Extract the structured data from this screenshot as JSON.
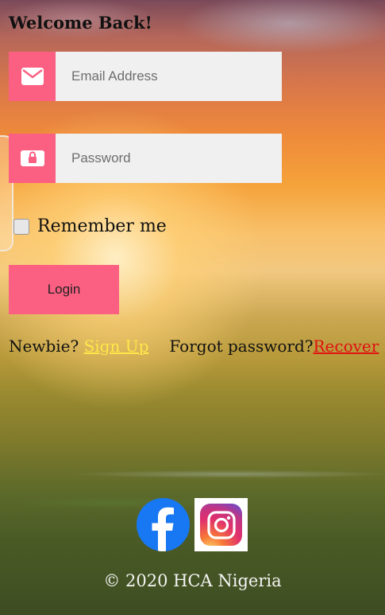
{
  "heading": "Welcome Back!",
  "email": {
    "placeholder": "Email Address",
    "icon": "envelope-icon"
  },
  "password": {
    "placeholder": "Password",
    "icon": "lock-icon"
  },
  "remember": {
    "label": "Remember me",
    "checked": false
  },
  "login": {
    "label": "Login"
  },
  "links": {
    "newbie_text": "Newbie?",
    "signup_label": "Sign Up",
    "forgot_text": "Forgot password?",
    "recover_label": "Recover"
  },
  "social": {
    "facebook": "facebook-icon",
    "instagram": "instagram-icon"
  },
  "footer": "© 2020 HCA Nigeria",
  "colors": {
    "accent": "#fb5f82",
    "input_bg": "#f0f0f0",
    "signup_link": "#ffe84a",
    "recover_link": "#e01010",
    "facebook": "#1877f2"
  }
}
